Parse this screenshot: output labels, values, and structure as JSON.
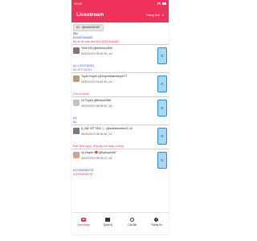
{
  "status": {
    "time": "09:45"
  },
  "app": {
    "title": "Livestream",
    "page_select": "Trang live"
  },
  "filter": {
    "chip": "#2 - @mebi030407"
  },
  "feed_top": {
    "line0": "351",
    "line1": "B10937648369",
    "line2": "B1 sz M màu đen 8% @937648369"
  },
  "comments": [
    {
      "name": "Trinh Nữ |@trinhnu1808",
      "time": "06/03/2023 08:46:45 | #2",
      "msg1": "A1 1 927716761",
      "msg2": "A1 927716761",
      "msg1_color": "blue",
      "msg2_color": "pink",
      "button": "C"
    },
    {
      "name": "Tuyết Huỳnh |@huynhthianhtuyet77",
      "time": "06/03/2023 08:46:45 | #2",
      "msg1": "Chị cò chưa",
      "msg2": "",
      "msg1_color": "pink",
      "msg2_color": "pink",
      "button": "C"
    },
    {
      "name": "Lê Tuyền |@letuyet366",
      "time": "06/03/2023 08:46:50 | #2",
      "msg1": "A1",
      "msg2": "A1",
      "msg1_color": "blue",
      "msg2_color": "blue",
      "button": "C"
    },
    {
      "name": "ß_NỮ VÕ TÂM 🛒 |@vuthithuhien31.10",
      "time": "06/03/2023 08:46:58 | #2",
      "msg1": "Đặt. Nếm qua . Khi nào mơ ship v shop",
      "msg2": "",
      "msg1_color": "pink",
      "msg2_color": "pink",
      "button": "C"
    },
    {
      "name": "Vy Huyền ❤️ |@vyhuyen87",
      "time": "06/03/2023 08:49:01 | #2",
      "msg1": "A1 0354956178",
      "msg2": "A10354956178",
      "msg1_color": "blue",
      "msg2_color": "pink",
      "button": "C"
    }
  ],
  "tabs": [
    {
      "label": "Livestream",
      "icon": "camera-icon",
      "active": true
    },
    {
      "label": "Quản lý",
      "icon": "folder-icon",
      "active": false
    },
    {
      "label": "Cài đặt",
      "icon": "gear-icon",
      "active": false
    },
    {
      "label": "Thông tin",
      "icon": "info-icon",
      "active": false
    }
  ],
  "colors": {
    "primary": "#f0325a",
    "blue_text": "#2b4fd6",
    "button_bg": "#a8d8f4"
  }
}
